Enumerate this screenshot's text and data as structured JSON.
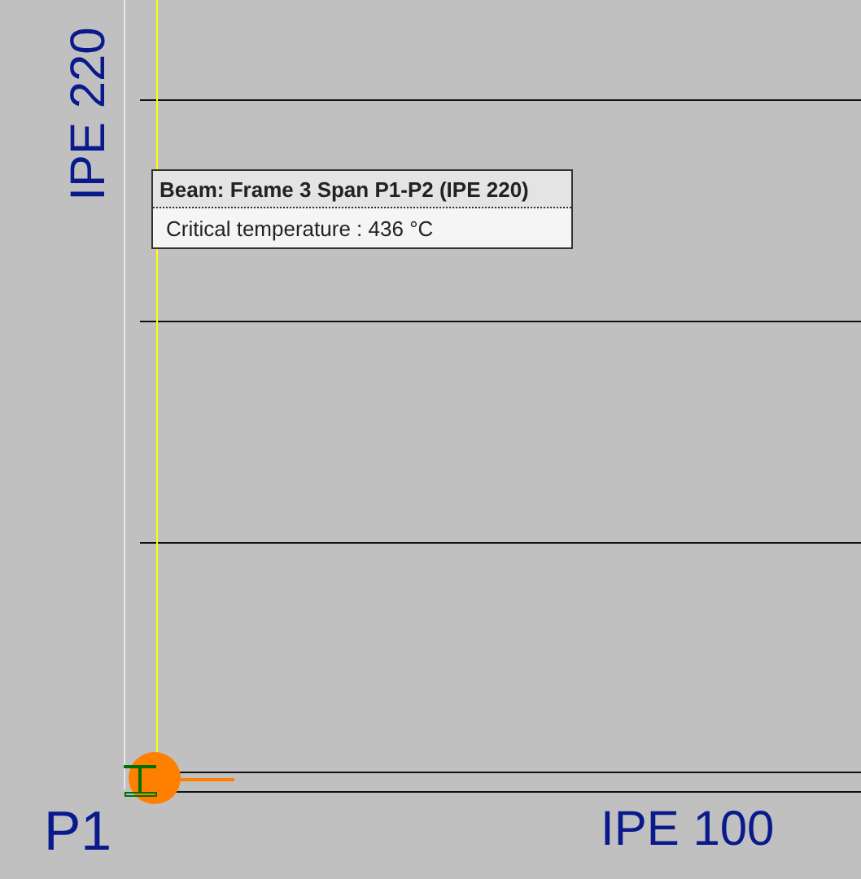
{
  "canvas": {
    "column_section": "IPE 220",
    "node_label": "P1",
    "beam_section": "IPE 100"
  },
  "tooltip": {
    "title": "Beam: Frame 3 Span P1-P2 (IPE 220)",
    "lines": [
      "Critical temperature : 436 °C"
    ]
  }
}
